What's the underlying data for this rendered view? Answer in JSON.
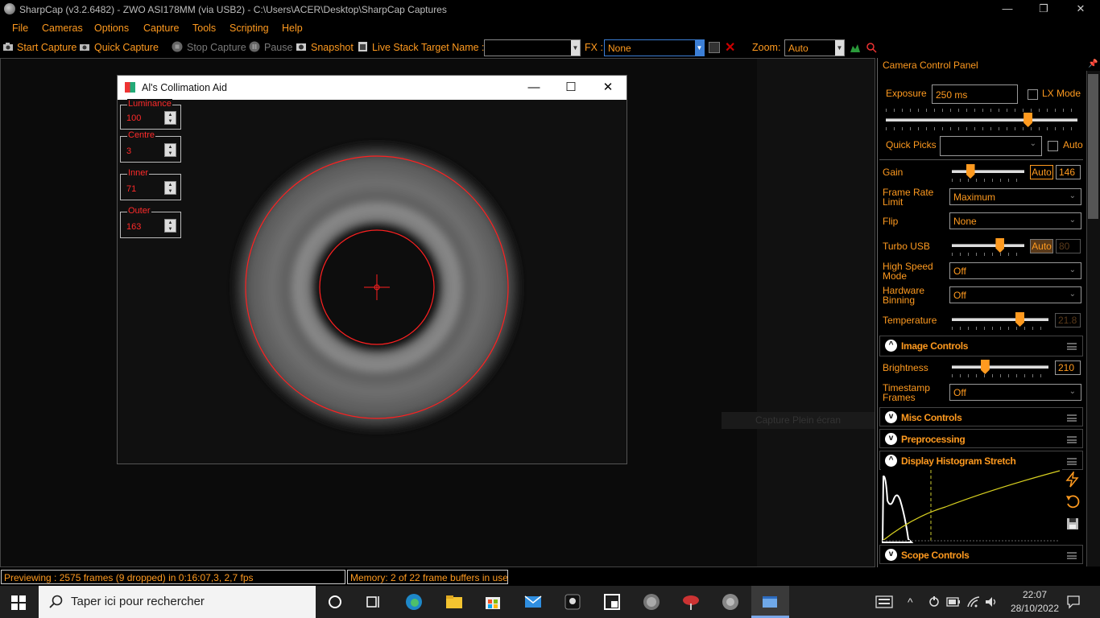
{
  "window": {
    "title": "SharpCap (v3.2.6482) - ZWO ASI178MM (via USB2) - C:\\Users\\ACER\\Desktop\\SharpCap Captures",
    "minimize": "—",
    "restore": "❐",
    "close": "✕"
  },
  "menu": [
    "File",
    "Cameras",
    "Options",
    "Capture",
    "Tools",
    "Scripting",
    "Help"
  ],
  "toolbar": {
    "start_capture": "Start Capture",
    "quick_capture": "Quick Capture",
    "stop_capture": "Stop Capture",
    "pause": "Pause",
    "snapshot": "Snapshot",
    "live_stack": "Live Stack",
    "target_name_label": "Target Name :",
    "target_name_value": "",
    "fx_label": "FX :",
    "fx_value": "None",
    "zoom_label": "Zoom:",
    "zoom_value": "Auto"
  },
  "collimation": {
    "title": "Al's Collimation Aid",
    "luminance_label": "Luminance",
    "luminance_value": "100",
    "centre_label": "Centre",
    "centre_value": "3",
    "inner_label": "Inner",
    "inner_value": "71",
    "outer_label": "Outer",
    "outer_value": "163"
  },
  "overlay_text": "Capture Plein écran",
  "panel": {
    "title": "Camera Control Panel",
    "exposure_label": "Exposure",
    "exposure_value": "250 ms",
    "lx_mode_label": "LX Mode",
    "quick_picks_label": "Quick Picks",
    "quick_picks_value": "",
    "quick_picks_auto": "Auto",
    "gain_label": "Gain",
    "gain_auto": "Auto",
    "gain_value": "146",
    "gain_level": 0.25,
    "frame_rate_label": "Frame Rate Limit",
    "frame_rate_value": "Maximum",
    "flip_label": "Flip",
    "flip_value": "None",
    "turbo_label": "Turbo USB",
    "turbo_auto": "Auto",
    "turbo_value": "80",
    "turbo_level": 0.66,
    "high_speed_label": "High Speed Mode",
    "high_speed_value": "Off",
    "binning_label": "Hardware Binning",
    "binning_value": "Off",
    "temperature_label": "Temperature",
    "temperature_value": "21.8",
    "temperature_level": 0.7,
    "exposure_level": 0.74,
    "image_controls": "Image Controls",
    "brightness_label": "Brightness",
    "brightness_value": "210",
    "brightness_level": 0.34,
    "timestamp_label": "Timestamp Frames",
    "timestamp_value": "Off",
    "misc_controls": "Misc Controls",
    "preprocessing": "Preprocessing",
    "histogram": "Display Histogram Stretch",
    "scope_controls": "Scope Controls"
  },
  "status": {
    "preview": "Previewing : 2575 frames (9 dropped) in 0:16:07,3, 2,7 fps",
    "memory": "Memory: 2 of 22 frame buffers in use"
  },
  "taskbar": {
    "search_placeholder": "Taper ici pour rechercher",
    "time": "22:07",
    "date": "28/10/2022"
  },
  "colors": {
    "accent": "#ff9a1f",
    "overlay_red": "#ff2020",
    "histogram_curve": "#d8d020"
  }
}
